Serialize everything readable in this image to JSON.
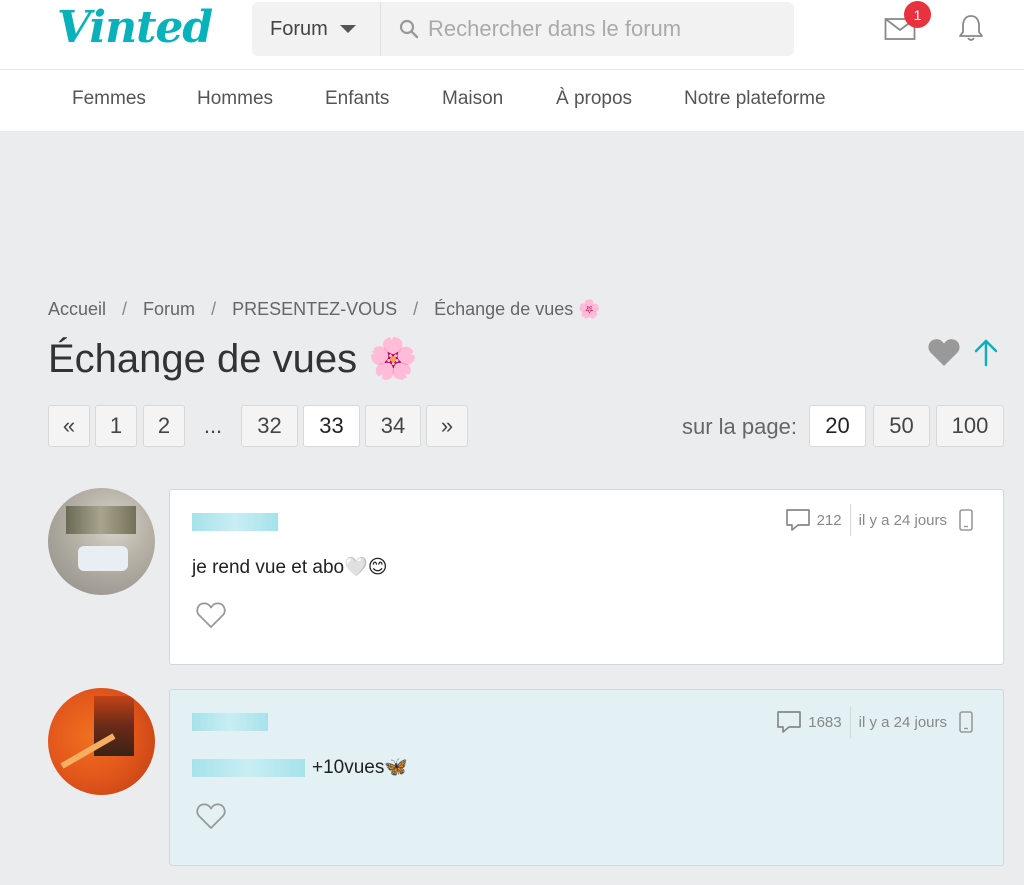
{
  "header": {
    "logo": "Vinted",
    "forum_select": "Forum",
    "search_placeholder": "Rechercher dans le forum",
    "notification_badge": "1",
    "brand_color": "#09b1ba"
  },
  "nav": {
    "categories": [
      "Femmes",
      "Hommes",
      "Enfants",
      "Maison",
      "À propos",
      "Notre plateforme"
    ]
  },
  "breadcrumb": {
    "items": [
      "Accueil",
      "Forum",
      "PRESENTEZ-VOUS",
      "Échange de vues 🌸"
    ],
    "separator": "/"
  },
  "page": {
    "title": "Échange de vues 🌸"
  },
  "pagination": {
    "prev": "«",
    "next": "»",
    "pages": [
      "1",
      "2",
      "...",
      "32",
      "33",
      "34"
    ],
    "current": "33",
    "per_page_label": "sur la page:",
    "per_page_options": [
      "20",
      "50",
      "100"
    ],
    "per_page_selected": "20"
  },
  "posts": [
    {
      "comment_count": "212",
      "time": "il y a 24 jours",
      "text": "je rend vue et abo🤍😊",
      "device_icon": "phone-icon"
    },
    {
      "comment_count": "1683",
      "time": "il y a 24 jours",
      "text": "+10vues🦋",
      "device_icon": "phone-icon"
    }
  ]
}
